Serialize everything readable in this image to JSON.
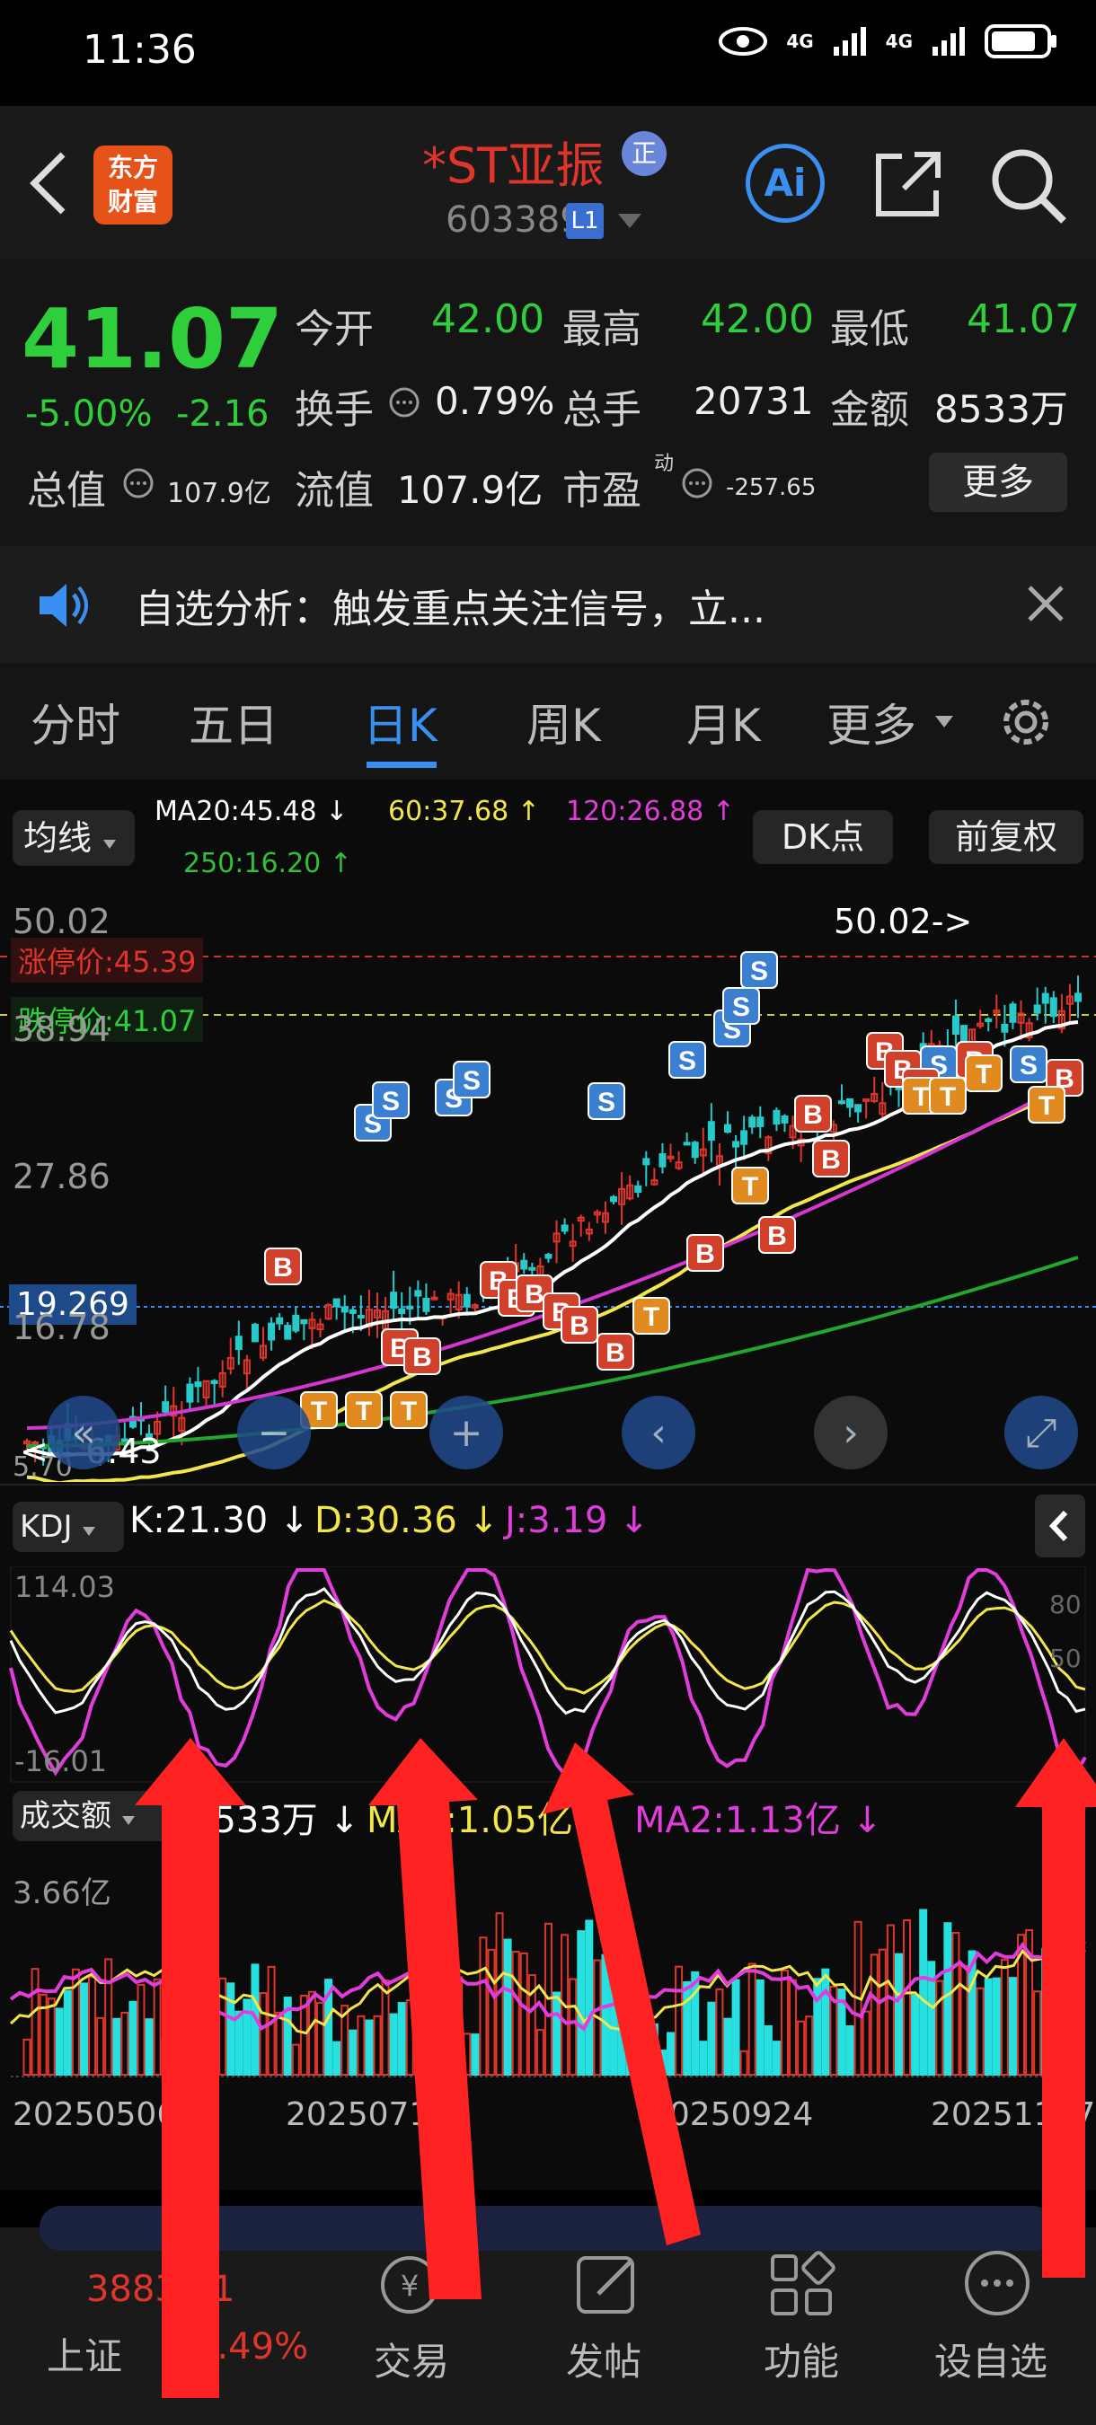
{
  "status_bar": {
    "time": "11:36",
    "net1": "4G",
    "net2": "4G"
  },
  "header": {
    "logo_line1": "东方",
    "logo_line2": "财富",
    "stock_name": "*ST亚振",
    "badge": "正",
    "stock_code": "603389",
    "level": "L1",
    "ai_label": "Ai"
  },
  "quote": {
    "price": "41.07",
    "pct": "-5.00%",
    "change": "-2.16",
    "open_label": "今开",
    "open": "42.00",
    "high_label": "最高",
    "high": "42.00",
    "low_label": "最低",
    "low": "41.07",
    "turnover_label": "换手",
    "turnover": "0.79%",
    "vol_label": "总手",
    "vol": "20731",
    "amount_label": "金额",
    "amount": "8533万",
    "mcap_label": "总值",
    "mcap": "107.9亿",
    "float_label": "流值",
    "float": "107.9亿",
    "pe_label": "市盈",
    "pe_sup": "动",
    "pe": "-257.65",
    "more": "更多"
  },
  "notice": {
    "text": "自选分析：触发重点关注信号，立..."
  },
  "tabs": [
    "分时",
    "五日",
    "日K",
    "周K",
    "月K",
    "更多"
  ],
  "active_tab": 2,
  "ma_bar": {
    "select": "均线",
    "ma20": "MA20:45.48 ↓",
    "ma60": "60:37.68 ↑",
    "ma120": "120:26.88 ↑",
    "ma250": "250:16.20 ↑",
    "dk": "DK点",
    "adj": "前复权"
  },
  "kchart": {
    "top_price": "50.02",
    "limit_up": "涨停价:45.39",
    "limit_down": "跌停价:41.07",
    "p2": "38.94",
    "p3": "27.86",
    "cursor": "19.269",
    "p4": "16.78",
    "p5": "5.70",
    "high_mark": "50.02->",
    "low_mark": "<---6.43"
  },
  "kdj": {
    "select": "KDJ",
    "k": "K:21.30 ↓",
    "d": "D:30.36 ↓",
    "j": "J:3.19 ↓",
    "top": "114.03",
    "bottom": "-16.01",
    "r80": "80",
    "r50": "50"
  },
  "volume": {
    "select": "成交额",
    "val": "8533万 ↓",
    "ma1": "MA1:1.05亿 ↓",
    "ma2": "MA2:1.13亿 ↓",
    "max": "3.66亿",
    "dates": [
      "20250506",
      "20250711",
      "20250924",
      "20251117"
    ]
  },
  "bottom": {
    "index_value": "3883.21",
    "index_name": "上证",
    "index_pct": "0.49%",
    "items": [
      "交易",
      "发帖",
      "功能",
      "设自选"
    ]
  },
  "colors": {
    "green": "#2fcf3c",
    "red": "#e0352b",
    "blue": "#3a8ff0",
    "yellow": "#f2e64b",
    "magenta": "#e23ddc"
  }
}
